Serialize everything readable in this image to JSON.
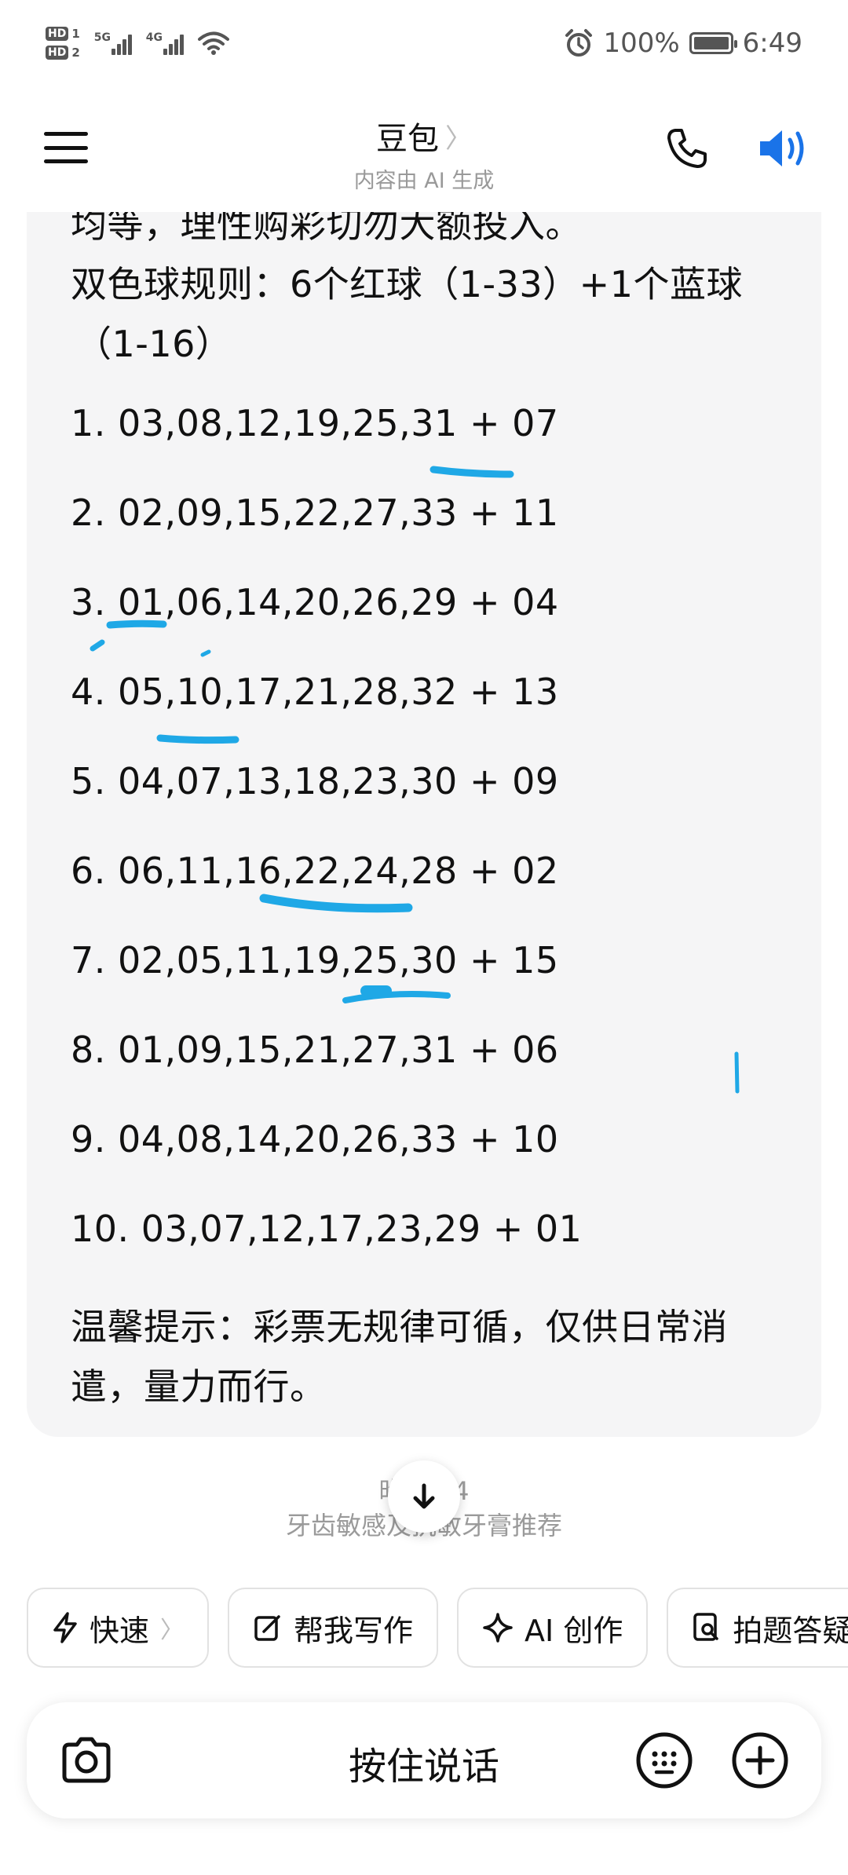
{
  "status_bar": {
    "sim1": "HD",
    "sim1_num": "1",
    "sim2": "HD",
    "sim2_num": "2",
    "net1": "5G",
    "net2": "4G",
    "battery_text": "100%",
    "time": "6:49"
  },
  "header": {
    "title": "豆包",
    "title_chevron": "〉",
    "subtitle": "内容由 AI 生成"
  },
  "message": {
    "partial_line": "均等，理性购彩切勿大额投入。",
    "rule_line1": "双色球规则：6个红球（1-33）+1个蓝球",
    "rule_line2": "（1-16）",
    "picks": [
      "1. 03,08,12,19,25,31 + 07",
      "2. 02,09,15,22,27,33 + 11",
      "3. 01,06,14,20,26,29 + 04",
      "4. 05,10,17,21,28,32 + 13",
      "5. 04,07,13,18,23,30 + 09",
      "6. 06,11,16,22,24,28 + 02",
      "7. 02,05,11,19,25,30 + 15",
      "8. 01,09,15,21,27,31 + 06",
      "9. 04,08,14,20,26,33 + 10",
      "10. 03,07,12,17,23,29 + 01"
    ],
    "tip_line1": "温馨提示：彩票无规律可循，仅供日常消",
    "tip_line2": "遣，量力而行。"
  },
  "timestamp": "昨天 14",
  "suggestion": "牙齿敏感及抗敏牙膏推荐",
  "chips": [
    {
      "icon": "lightning-icon",
      "label": "快速",
      "arrow": "〉"
    },
    {
      "icon": "edit-icon",
      "label": "帮我写作"
    },
    {
      "icon": "sparkle-icon",
      "label": "AI 创作"
    },
    {
      "icon": "photo-search-icon",
      "label": "拍题答疑"
    }
  ],
  "input_bar": {
    "hold_to_talk": "按住说话"
  },
  "colors": {
    "accent_blue": "#1a73e8",
    "marker_blue": "#1fa8e6",
    "bubble_bg": "#f5f5f6"
  }
}
